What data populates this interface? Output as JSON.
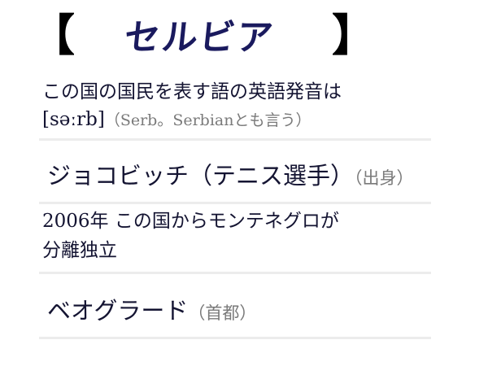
{
  "title": {
    "open_bracket": "【",
    "text": "セルビア",
    "close_bracket": "】"
  },
  "question": {
    "line1": "この国の国民を表す語の英語発音は",
    "pronunciation": "[səːrb]",
    "note": "（Serb。Serbianとも言う）"
  },
  "answers": [
    {
      "text": "ジョコビッチ（テニス選手）",
      "note": "（出身）"
    },
    {
      "line1": "2006年 この国からモンテネグロが",
      "line2": "分離独立"
    },
    {
      "text": "ベオグラード",
      "note": "（首都）"
    }
  ]
}
